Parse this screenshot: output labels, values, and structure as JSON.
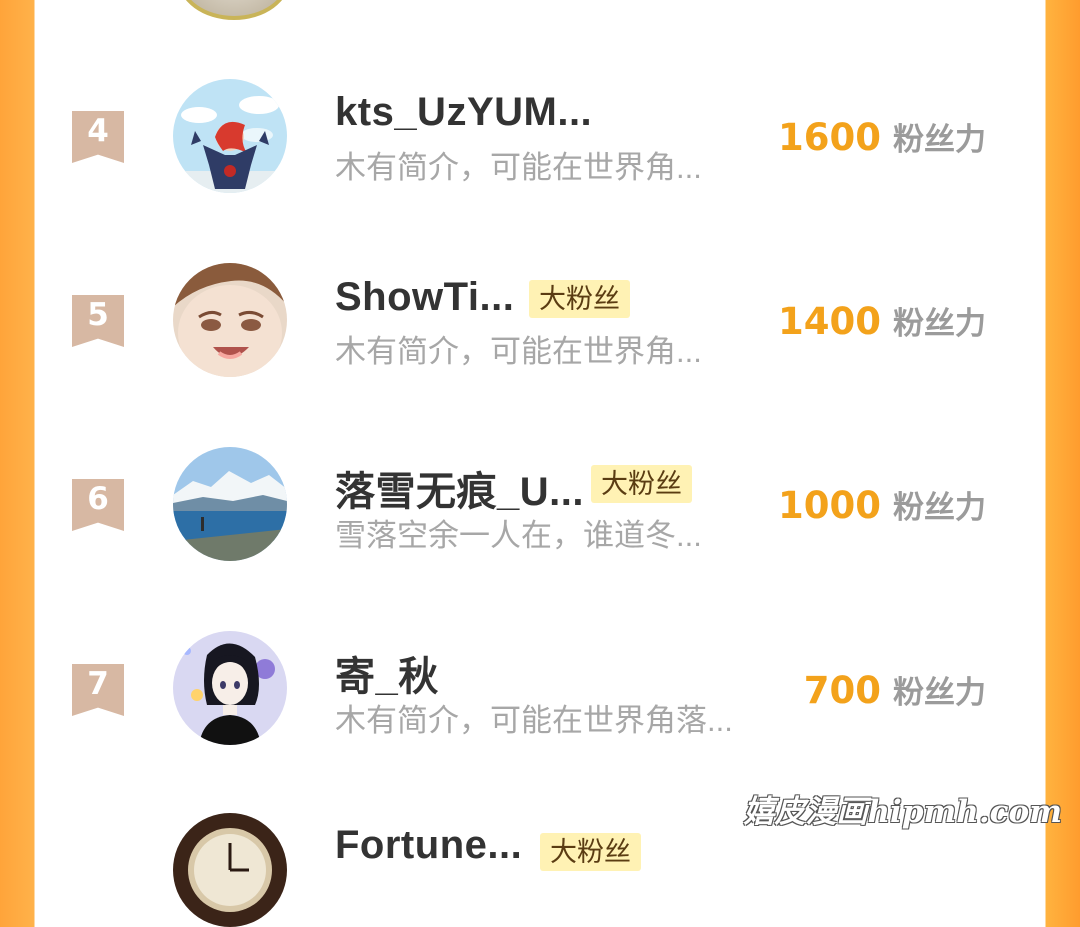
{
  "rows": [
    {
      "rank": "4",
      "name": "kts_UzYUM...",
      "badge": "",
      "bio": "木有简介，可能在世界角...",
      "fans": "1600",
      "fans_unit": "粉丝力",
      "avatar_icon": "cartoon-character-avatar-icon"
    },
    {
      "rank": "5",
      "name": "ShowTi...",
      "badge": "大粉丝",
      "bio": "木有简介，可能在世界角...",
      "fans": "1400",
      "fans_unit": "粉丝力",
      "avatar_icon": "anime-face-avatar-icon"
    },
    {
      "rank": "6",
      "name": "落雪无痕_U...",
      "badge": "大粉丝",
      "bio": "雪落空余一人在，谁道冬...",
      "fans": "1000",
      "fans_unit": "粉丝力",
      "avatar_icon": "snow-mountain-avatar-icon"
    },
    {
      "rank": "7",
      "name": "寄_秋",
      "badge": "",
      "bio": "木有简介，可能在世界角落...",
      "fans": "700",
      "fans_unit": "粉丝力",
      "avatar_icon": "anime-girl-avatar-icon"
    }
  ],
  "partial_next": {
    "name": "Fortune...",
    "badge": "大粉丝",
    "avatar_icon": "clock-avatar-icon"
  },
  "watermark": "嬉皮漫画hipmh.com",
  "colors": {
    "side_orange": "#ffa43a",
    "fans_count": "#f3a21b",
    "rank_badge": "#d7b8a3",
    "fan_badge_bg": "#fff2b4"
  }
}
